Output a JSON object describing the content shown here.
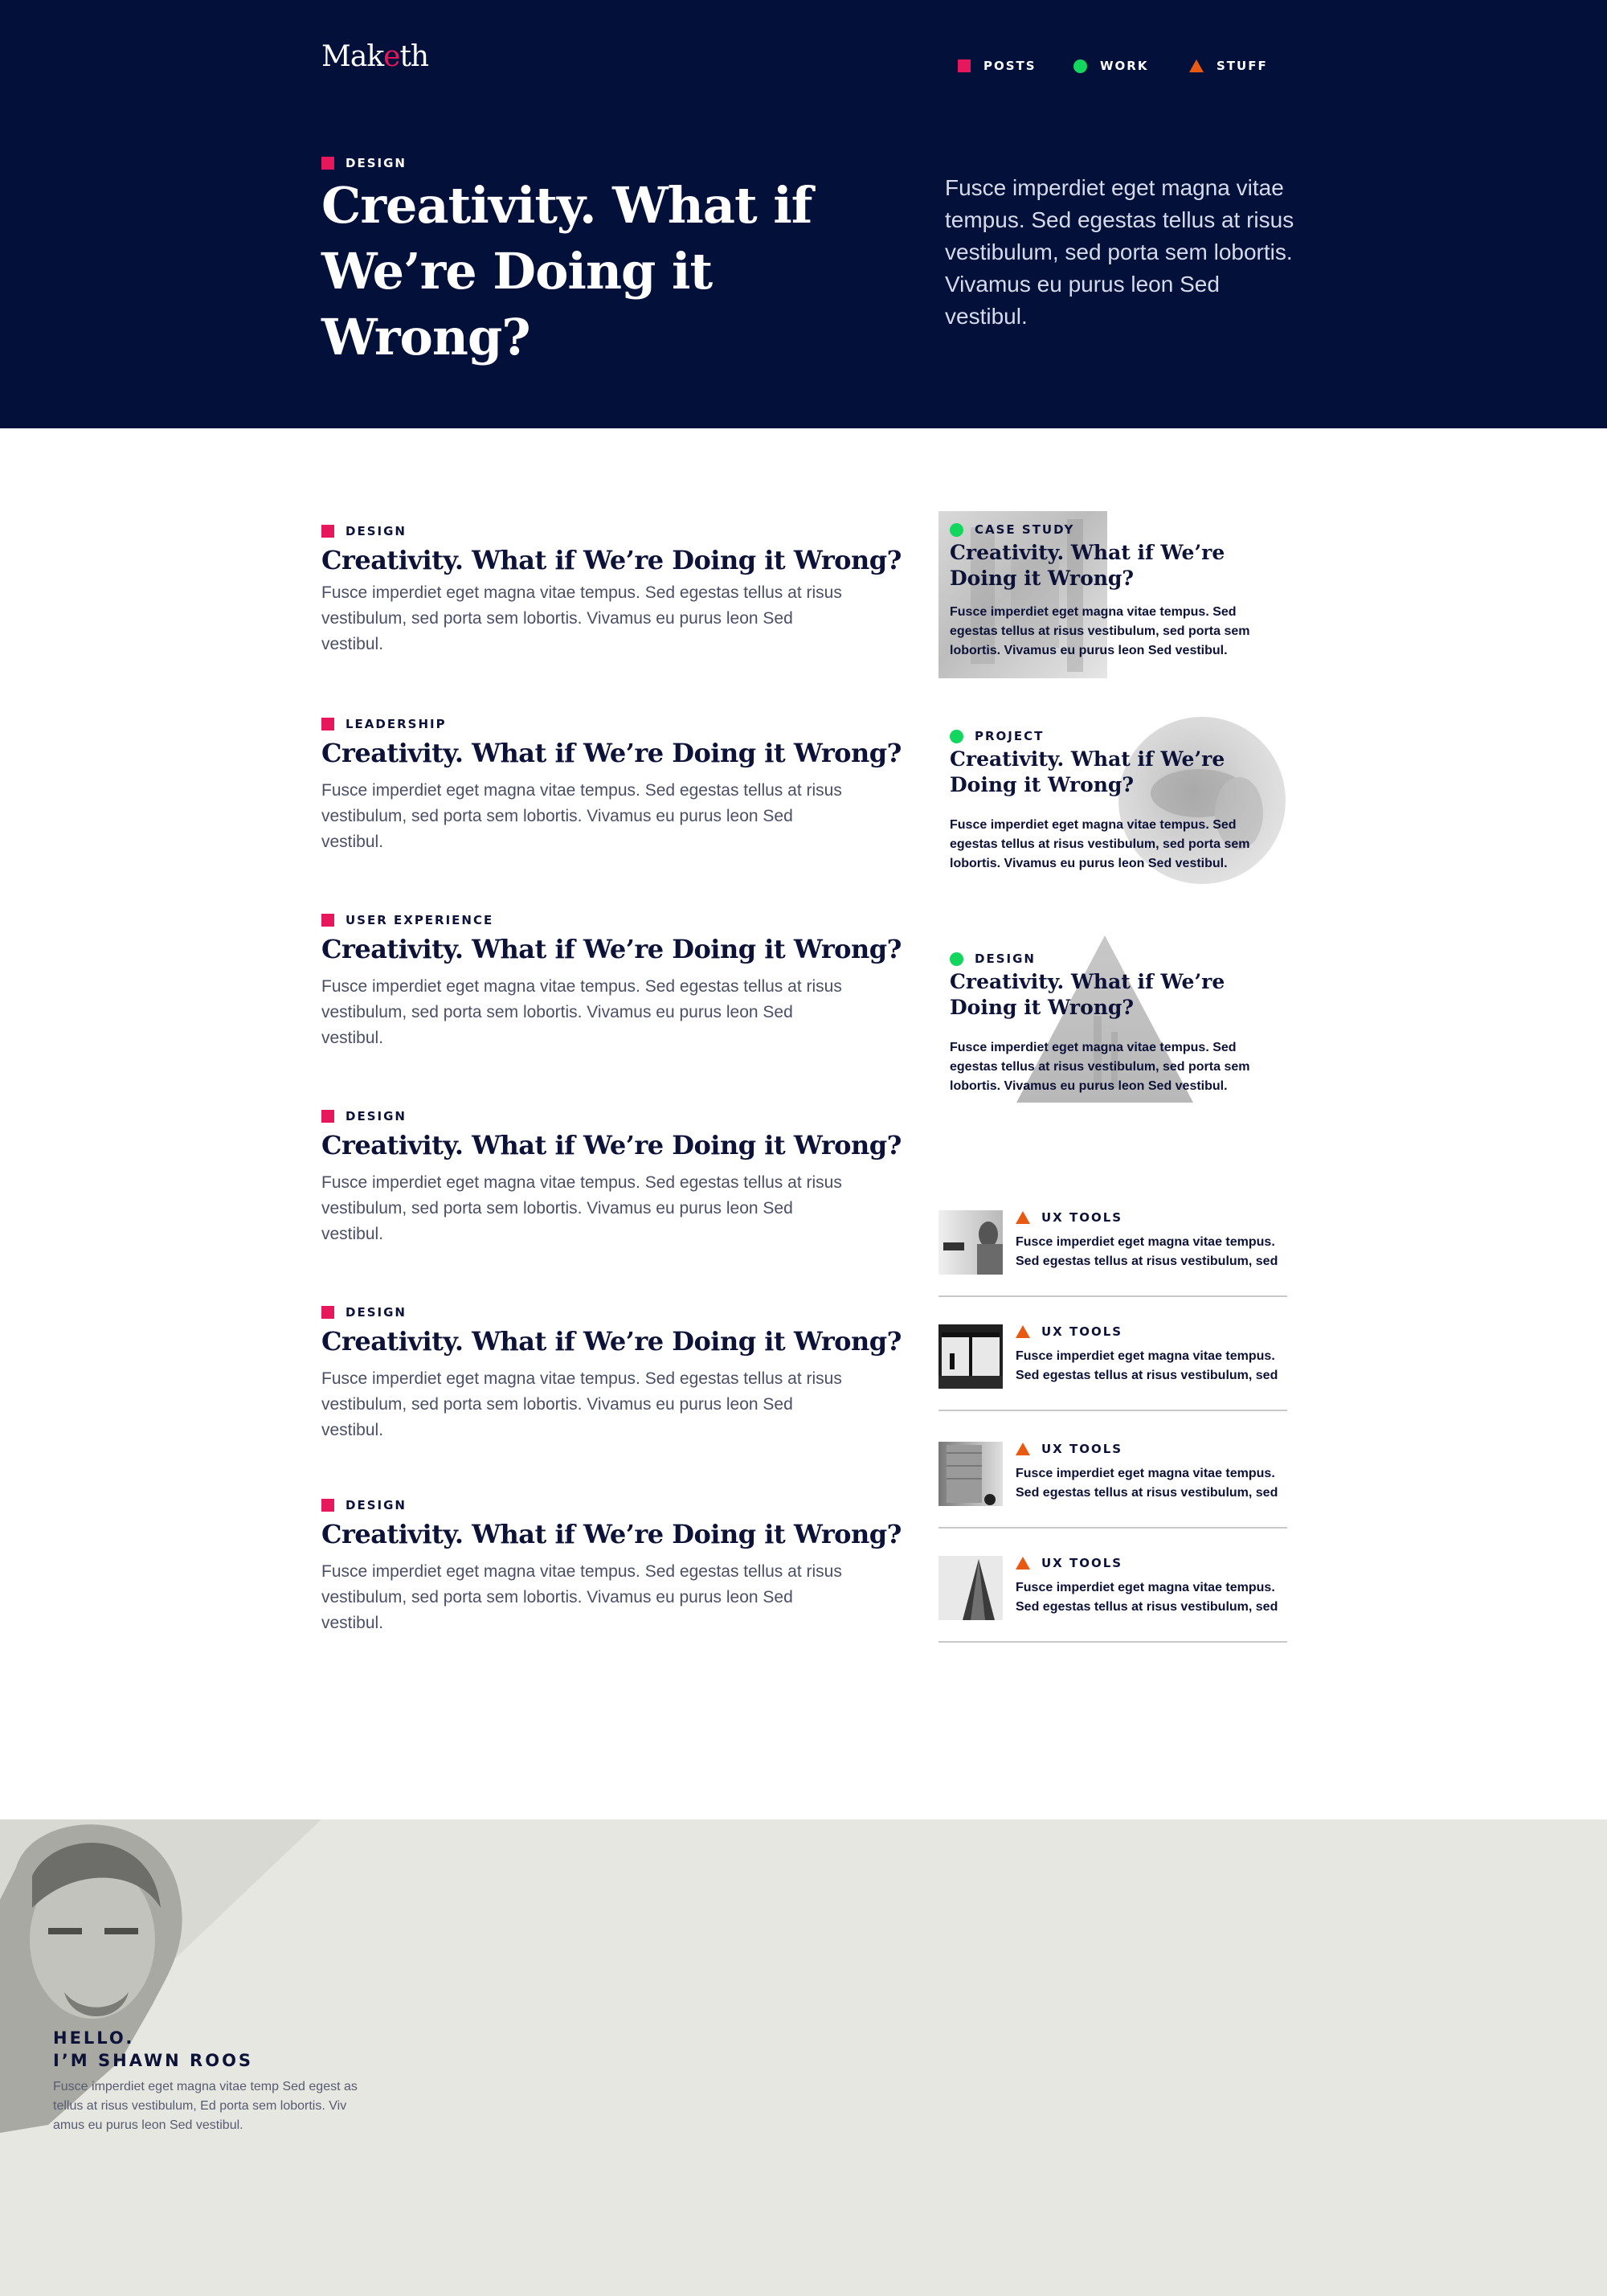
{
  "brand": {
    "logo_pre": "Mak",
    "logo_accent": "e",
    "logo_post": "th"
  },
  "nav": [
    {
      "label": "POSTS",
      "icon": "square-icon",
      "color": "#e6175c"
    },
    {
      "label": "WORK",
      "icon": "circle-icon",
      "color": "#12d65e"
    },
    {
      "label": "STUFF",
      "icon": "triangle-icon",
      "color": "#e85a12"
    }
  ],
  "hero": {
    "category": "DESIGN",
    "title_line1": "Creativity. What if",
    "title_line2": "We’re  Doing it Wrong?",
    "lead": "Fusce imperdiet eget magna vitae tempus. Sed egestas tellus at risus vestibulum, sed porta sem lobortis. Vivamus eu purus leon Sed vestibul."
  },
  "posts": [
    {
      "category": "DESIGN",
      "title": "Creativity. What if We’re Doing it Wrong?",
      "excerpt": "Fusce imperdiet eget magna vitae tempus. Sed egestas tellus at risus vestibulum, sed porta sem lobortis. Vivamus eu purus leon Sed vestibul."
    },
    {
      "category": "LEADERSHIP",
      "title": "Creativity. What if We’re Doing it Wrong?",
      "excerpt": "Fusce imperdiet eget magna vitae tempus. Sed egestas tellus at risus vestibulum, sed porta sem lobortis. Vivamus eu purus leon Sed vestibul."
    },
    {
      "category": "USER EXPERIENCE",
      "title": "Creativity. What if We’re Doing it Wrong?",
      "excerpt": "Fusce imperdiet eget magna vitae tempus. Sed egestas tellus at risus vestibulum, sed porta sem lobortis. Vivamus eu purus leon Sed vestibul."
    },
    {
      "category": "DESIGN",
      "title": "Creativity. What if We’re Doing it Wrong?",
      "excerpt": "Fusce imperdiet eget magna vitae tempus. Sed egestas tellus at risus vestibulum, sed porta sem lobortis. Vivamus eu purus leon Sed vestibul."
    },
    {
      "category": "DESIGN",
      "title": "Creativity. What if We’re Doing it Wrong?",
      "excerpt": "Fusce imperdiet eget magna vitae tempus. Sed egestas tellus at risus vestibulum, sed porta sem lobortis. Vivamus eu purus leon Sed vestibul."
    },
    {
      "category": "DESIGN",
      "title": "Creativity. What if We’re Doing it Wrong?",
      "excerpt": "Fusce imperdiet eget magna vitae tempus. Sed egestas tellus at risus vestibulum, sed porta sem lobortis. Vivamus eu purus leon Sed vestibul."
    }
  ],
  "features": [
    {
      "category": "CASE STUDY",
      "title": "Creativity. What if We’re Doing it Wrong?",
      "excerpt": "Fusce imperdiet eget magna vitae tempus. Sed egestas tellus at risus vestibulum, sed porta sem lobortis. Vivamus eu purus leon Sed vestibul."
    },
    {
      "category": "PROJECT",
      "title": "Creativity. What if We’re Doing it Wrong?",
      "excerpt": "Fusce imperdiet eget magna vitae tempus. Sed egestas tellus at risus vestibulum, sed porta sem lobortis. Vivamus eu purus leon Sed vestibul."
    },
    {
      "category": "DESIGN",
      "title": "Creativity. What if We’re Doing it Wrong?",
      "excerpt": "Fusce imperdiet eget magna vitae tempus. Sed egestas tellus at risus vestibulum, sed porta sem lobortis. Vivamus eu purus leon Sed vestibul."
    }
  ],
  "tools": [
    {
      "category": "UX TOOLS",
      "excerpt": "Fusce imperdiet eget magna vitae tempus. Sed egestas tellus at risus vestibulum, sed"
    },
    {
      "category": "UX TOOLS",
      "excerpt": "Fusce imperdiet eget magna vitae tempus. Sed egestas tellus at risus vestibulum, sed"
    },
    {
      "category": "UX TOOLS",
      "excerpt": "Fusce imperdiet eget magna vitae tempus. Sed egestas tellus at risus vestibulum, sed"
    },
    {
      "category": "UX TOOLS",
      "excerpt": "Fusce imperdiet eget magna vitae tempus. Sed egestas tellus at risus vestibulum, sed"
    }
  ],
  "footer": {
    "hello_line1": "HELLO.",
    "hello_line2": "I’M SHAWN ROOS",
    "bio": "Fusce imperdiet eget magna vitae temp Sed egest as tellus at risus vestibulum, Ed porta sem lobortis. Viv amus eu purus leon Sed vestibul."
  }
}
